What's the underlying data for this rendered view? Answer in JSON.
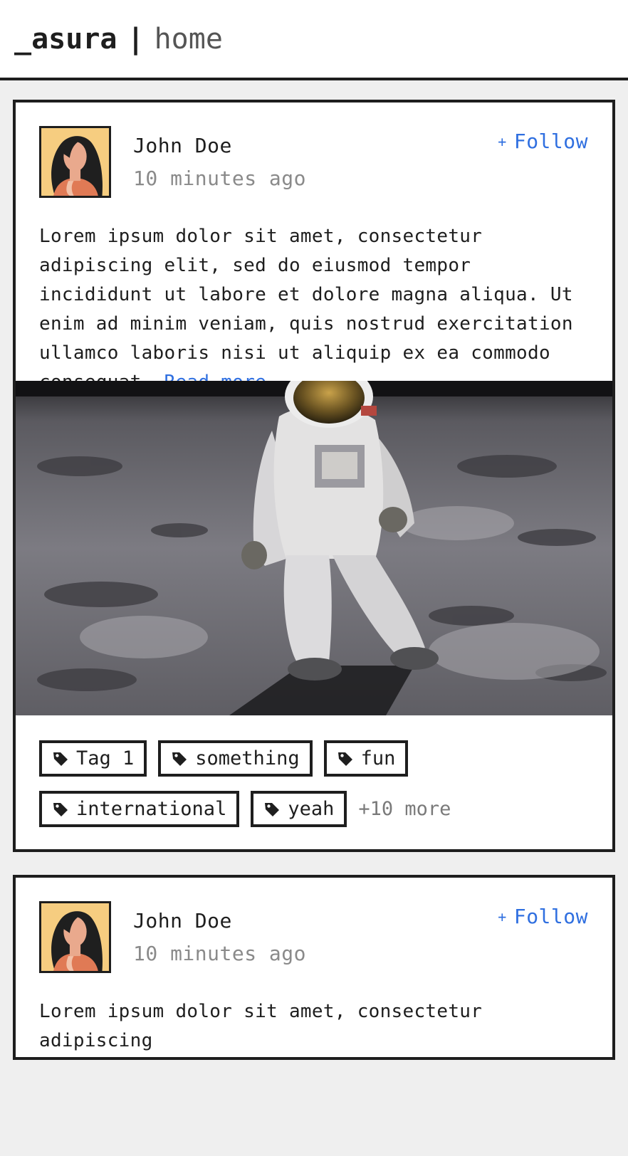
{
  "header": {
    "logo": "_asura",
    "separator": "|",
    "section": "home"
  },
  "posts": [
    {
      "author": "John Doe",
      "time": "10 minutes ago",
      "follow_label": "Follow",
      "follow_prefix": "+",
      "body": "Lorem ipsum dolor sit amet, consectetur adipiscing elit, sed do eiusmod tempor incididunt ut labore et dolore magna aliqua. Ut enim ad minim veniam, quis nostrud exercitation ullamco laboris nisi ut aliquip ex ea commodo consequat.",
      "read_more": "Read more..",
      "image_subject": "astronaut on the moon",
      "tags": [
        "Tag 1",
        "something",
        "fun",
        "international",
        "yeah"
      ],
      "more_tags": "+10 more"
    },
    {
      "author": "John Doe",
      "time": "10 minutes ago",
      "follow_label": "Follow",
      "follow_prefix": "+",
      "body": "Lorem ipsum dolor sit amet, consectetur adipiscing"
    }
  ],
  "colors": {
    "accent": "#2f6fe0",
    "border": "#1e1e1e",
    "background": "#efefef",
    "muted": "#8a8a8a"
  },
  "icons": [
    "tag-icon",
    "avatar-illustration"
  ]
}
